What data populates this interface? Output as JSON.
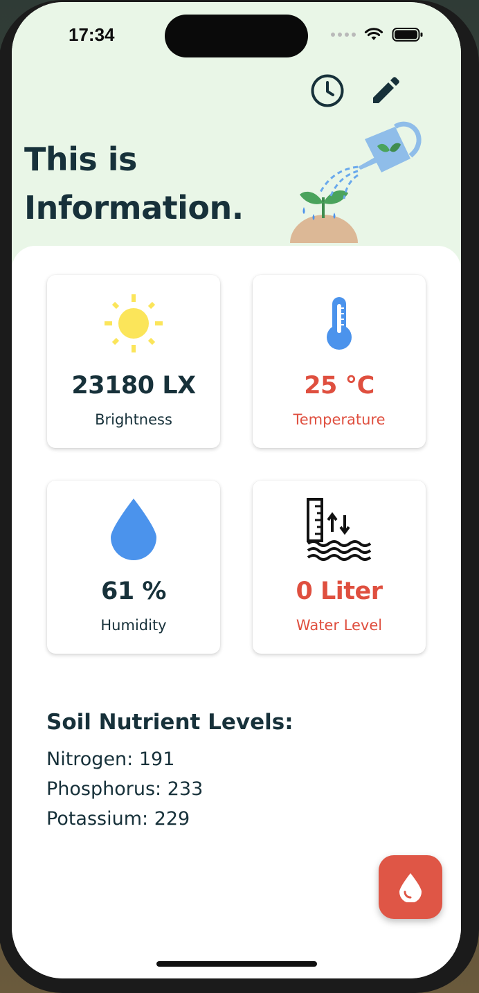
{
  "status_bar": {
    "time": "17:34",
    "icons": [
      "signal-dots-icon",
      "wifi-icon",
      "battery-icon"
    ]
  },
  "header": {
    "actions": [
      "history-clock-icon",
      "edit-pencil-icon"
    ],
    "title_line1": "This is",
    "title_line2": "Information.",
    "illustration": "watering-can-seedling-illustration",
    "background_color": "#e9f6e7"
  },
  "cards": [
    {
      "icon": "sun-icon",
      "value": "23180 LX",
      "label": "Brightness",
      "status": "normal"
    },
    {
      "icon": "thermometer-icon",
      "value": "25 °C",
      "label": "Temperature",
      "status": "alert"
    },
    {
      "icon": "water-drop-icon",
      "value": "61 %",
      "label": "Humidity",
      "status": "normal"
    },
    {
      "icon": "water-level-icon",
      "value": "0 Liter",
      "label": "Water Level",
      "status": "alert"
    }
  ],
  "soil": {
    "title": "Soil Nutrient Levels:",
    "items": [
      "Nitrogen: 191",
      "Phosphorus: 233",
      "Potassium: 229"
    ]
  },
  "fab": {
    "icon": "water-drop-icon"
  },
  "colors": {
    "text_dark": "#17313a",
    "alert_red": "#df4f3f",
    "fab_red": "#df5646",
    "sun_yellow": "#fbe55a",
    "drop_blue": "#4b93ec"
  }
}
